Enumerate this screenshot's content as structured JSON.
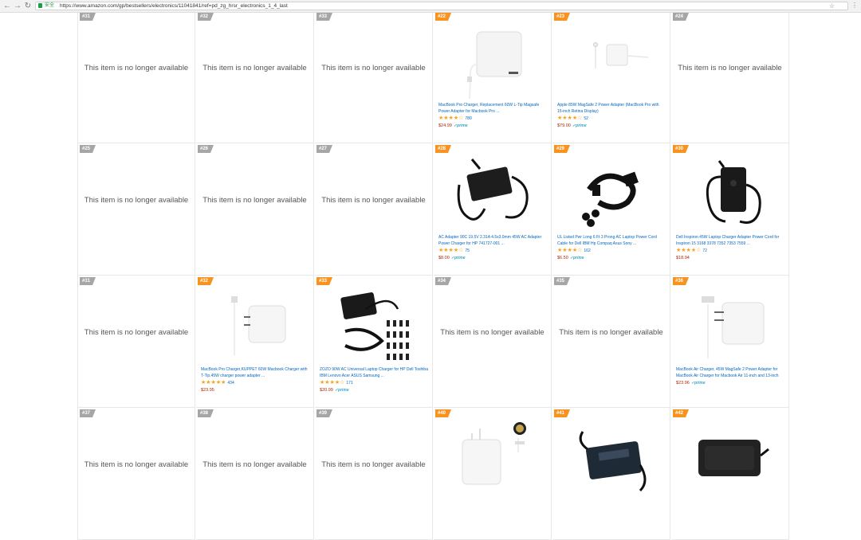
{
  "browser": {
    "secure_label": "安全",
    "url": "https://www.amazon.com/gp/bestsellers/electronics/11041841/ref=pd_zg_hrsr_electronics_1_4_last"
  },
  "cells": [
    {
      "rank": "#31",
      "unavailable": "This item is no longer available"
    },
    {
      "rank": "#32",
      "unavailable": "This item is no longer available"
    },
    {
      "rank": "#33",
      "unavailable": "This item is no longer available"
    },
    {
      "rank": "#22",
      "image": "magsafe-l-charger",
      "title": "MacBook Pro Charger, Replacement 60W L-Tip Magsafe Power Adapter for Macbook Pro ...",
      "stars": "★★★★☆",
      "rating_count": "780",
      "price": "$24.99",
      "prime": "✓prime"
    },
    {
      "rank": "#23",
      "image": "magsafe2-adapter",
      "title": "Apple 85W MagSafe 2 Power Adapter (MacBook Pro with 15-inch Retina Display)",
      "stars": "★★★★☆",
      "rating_count": "52",
      "price": "$79.00",
      "prime": "✓prime"
    },
    {
      "rank": "#24",
      "unavailable": "This item is no longer available"
    },
    {
      "rank": "#25",
      "unavailable": "This item is no longer available"
    },
    {
      "rank": "#26",
      "unavailable": "This item is no longer available"
    },
    {
      "rank": "#27",
      "unavailable": "This item is no longer available"
    },
    {
      "rank": "#28",
      "image": "black-laptop-charger",
      "title": "AC Adapter 90C 19.5V 2.31A 4.5x3.0mm 45W AC Adapter Power Charger for HP 741727-001 ...",
      "stars": "★★★★☆",
      "rating_count": "75",
      "price": "$8.00",
      "prime": "✓prime"
    },
    {
      "rank": "#29",
      "image": "power-cord",
      "title": "UL Listed Pwr Long 6 Ft 3 Prong AC Laptop Power Cord Cable for Dell IBM Hp Compaq Asus Sony ...",
      "stars": "★★★★☆",
      "rating_count": "162",
      "price": "$6.50",
      "prime": "✓prime"
    },
    {
      "rank": "#30",
      "image": "dell-charger",
      "title": "Dell Inspiron 45W Laptop Charger Adapter Power Cord for Inspiron 15 3168 3378 7352 7353 7559 ...",
      "stars": "★★★★☆",
      "rating_count": "72",
      "price": "$18.94",
      "prime": ""
    },
    {
      "rank": "#31",
      "unavailable": "This item is no longer available"
    },
    {
      "rank": "#32",
      "image": "magsafe2-white",
      "title": "MacBook Pro Charger,KUPPET 60W Macbook Charger with T-Tip,45W charger power adapter ...",
      "stars": "★★★★★",
      "rating_count": "434",
      "price": "$23.95",
      "prime": ""
    },
    {
      "rank": "#33",
      "image": "universal-charger",
      "title": "ZOZO 90W AC Universal Laptop Charger for HP Dell Toshiba IBM Lenovo Acer ASUS Samsung ...",
      "stars": "★★★★☆",
      "rating_count": "171",
      "price": "$20.99",
      "prime": "✓prime"
    },
    {
      "rank": "#34",
      "unavailable": "This item is no longer available"
    },
    {
      "rank": "#35",
      "unavailable": "This item is no longer available"
    },
    {
      "rank": "#36",
      "image": "magsafe2-t-tip",
      "title": "MacBook Air Charger, 45W MagSafe 2 Power Adapter for MacBook Air Charger for Macbook Air 11-inch and 13-inch",
      "stars": "",
      "rating_count": "",
      "price": "$23.96",
      "prime": "✓prime"
    },
    {
      "rank": "#37",
      "unavailable": "This item is no longer available"
    },
    {
      "rank": "#38",
      "unavailable": "This item is no longer available"
    },
    {
      "rank": "#39",
      "unavailable": "This item is no longer available"
    },
    {
      "rank": "#40",
      "image": "magsafe-white-badge"
    },
    {
      "rank": "#41",
      "image": "hp-charger"
    },
    {
      "rank": "#42",
      "image": "slim-charger"
    }
  ]
}
